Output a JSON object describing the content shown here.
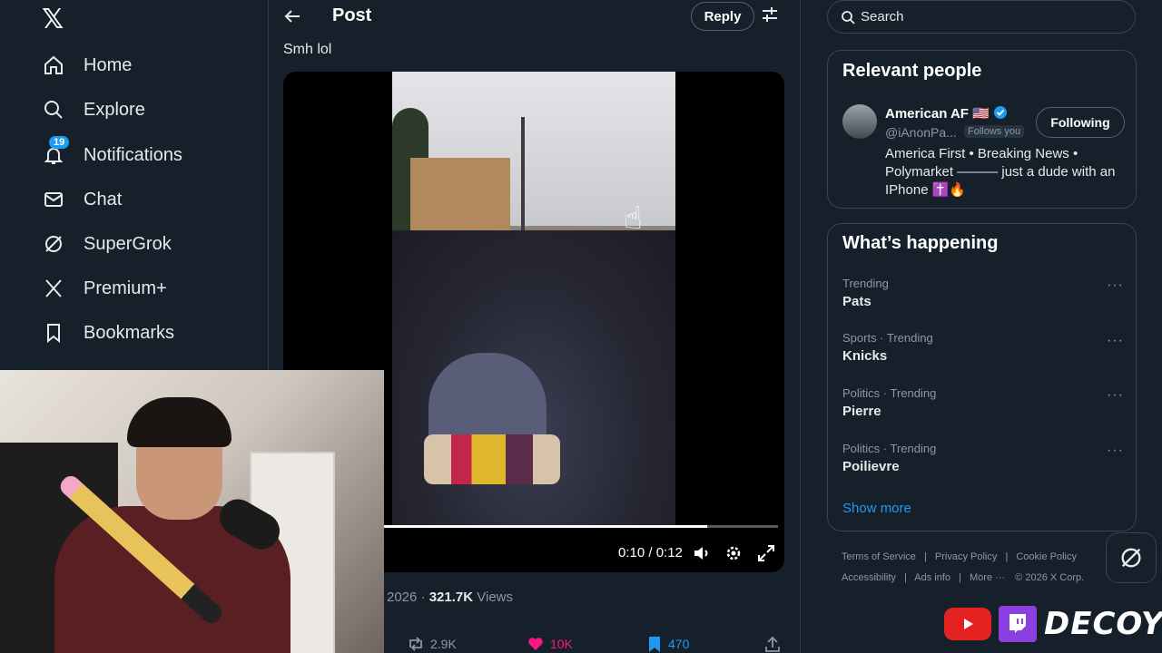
{
  "nav": {
    "logo": "𝕏",
    "items": [
      {
        "label": "Home",
        "icon": "home-icon"
      },
      {
        "label": "Explore",
        "icon": "search-icon"
      },
      {
        "label": "Notifications",
        "icon": "bell-icon",
        "badge": "19"
      },
      {
        "label": "Chat",
        "icon": "mail-icon"
      },
      {
        "label": "SuperGrok",
        "icon": "grok-icon"
      },
      {
        "label": "Premium+",
        "icon": "x-icon"
      },
      {
        "label": "Bookmarks",
        "icon": "bookmark-icon"
      }
    ]
  },
  "header": {
    "title": "Post",
    "reply_label": "Reply"
  },
  "post": {
    "text": "Smh lol",
    "video": {
      "time": "0:10 / 0:12",
      "progress": 0.82
    },
    "meta_date": "2026 ·",
    "views_count": "321.7K",
    "views_label": "Views",
    "retweets": "2.9K",
    "likes": "10K",
    "bookmarks": "470"
  },
  "search": {
    "placeholder": "Search"
  },
  "relevant": {
    "title": "Relevant people",
    "name": "American AF 🇺🇸",
    "handle": "@iAnonPa...",
    "follows_you": "Follows you",
    "following_label": "Following",
    "bio": "America First • Breaking News • Polymarket ——— just a dude with an IPhone ✝️🔥"
  },
  "happening": {
    "title": "What’s happening",
    "trends": [
      {
        "category": "Trending",
        "name": "Pats"
      },
      {
        "category": "Sports · Trending",
        "name": "Knicks"
      },
      {
        "category": "Politics · Trending",
        "name": "Pierre"
      },
      {
        "category": "Politics · Trending",
        "name": "Poilievre"
      }
    ],
    "show_more": "Show more"
  },
  "footer": {
    "line1": [
      "Terms of Service",
      "Privacy Policy",
      "Cookie Policy"
    ],
    "line2": [
      "Accessibility",
      "Ads info",
      "More ···",
      "© 2026 X Corp."
    ]
  },
  "overlay": {
    "brand": "DECOY"
  }
}
